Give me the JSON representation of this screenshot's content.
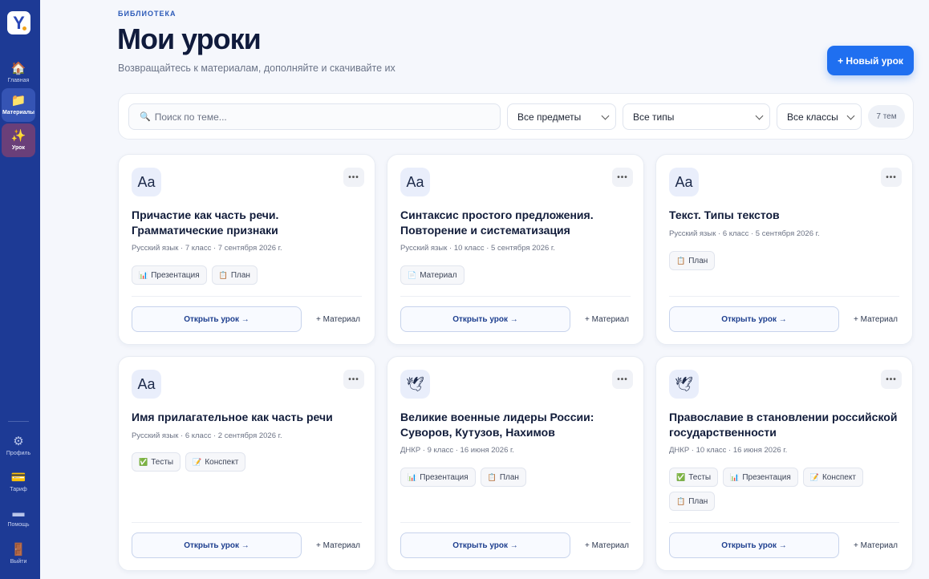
{
  "sidebar": {
    "logo_letter": "Y",
    "items": [
      {
        "label": "Главная",
        "icon": "home-icon",
        "glyph": "🏠"
      },
      {
        "label": "Материалы",
        "icon": "folder-icon",
        "glyph": "📁"
      },
      {
        "label": "Урок",
        "icon": "sparkles-icon",
        "glyph": "✨"
      },
      {
        "label": "Профиль",
        "icon": "gear-icon",
        "glyph": "⚙"
      },
      {
        "label": "Тариф",
        "icon": "credit-card-icon",
        "glyph": "💳"
      },
      {
        "label": "Помощь",
        "icon": "help-icon",
        "glyph": "▬"
      },
      {
        "label": "Выйти",
        "icon": "door-icon",
        "glyph": "🚪"
      }
    ]
  },
  "header": {
    "kicker": "БИБЛИОТЕКА",
    "title": "Мои уроки",
    "subtitle": "Возвращайтесь к материалам, дополняйте и скачивайте их",
    "new_button": "+ Новый урок"
  },
  "filters": {
    "search_placeholder": "Поиск по теме...",
    "search_value": "",
    "subjects": "Все предметы",
    "types": "Все типы",
    "grades": "Все классы",
    "count": "7 тем"
  },
  "card_common": {
    "more": "•••",
    "open": "Открыть урок →",
    "add": "+ Материал"
  },
  "cards": [
    {
      "icon": "Aa",
      "title": "Причастие как часть речи. Грамматические признаки",
      "meta": "Русский язык · 7 класс · 7 сентября 2026 г.",
      "tags": [
        {
          "g": "📊",
          "t": "Презентация"
        },
        {
          "g": "📋",
          "t": "План"
        }
      ]
    },
    {
      "icon": "Aa",
      "title": "Синтаксис простого предложения. Повторение и систематизация",
      "meta": "Русский язык · 10 класс · 5 сентября 2026 г.",
      "tags": [
        {
          "g": "📄",
          "t": "Материал"
        }
      ]
    },
    {
      "icon": "Aa",
      "title": "Текст. Типы текстов",
      "meta": "Русский язык · 6 класс · 5 сентября 2026 г.",
      "tags": [
        {
          "g": "📋",
          "t": "План"
        }
      ]
    },
    {
      "icon": "Aa",
      "title": "Имя прилагательное как часть речи",
      "meta": "Русский язык · 6 класс · 2 сентября 2026 г.",
      "tags": [
        {
          "g": "✅",
          "t": "Тесты"
        },
        {
          "g": "📝",
          "t": "Конспект"
        }
      ]
    },
    {
      "icon": "🕊",
      "title": "Великие военные лидеры России: Суворов, Кутузов, Нахимов",
      "meta": "ДНКР · 9 класс · 16 июня 2026 г.",
      "tags": [
        {
          "g": "📊",
          "t": "Презентация"
        },
        {
          "g": "📋",
          "t": "План"
        }
      ]
    },
    {
      "icon": "🕊",
      "title": "Православие в становлении российской государственности",
      "meta": "ДНКР · 10 класс · 16 июня 2026 г.",
      "tags": [
        {
          "g": "✅",
          "t": "Тесты"
        },
        {
          "g": "📊",
          "t": "Презентация"
        },
        {
          "g": "📝",
          "t": "Конспект"
        },
        {
          "g": "📋",
          "t": "План"
        }
      ]
    }
  ]
}
